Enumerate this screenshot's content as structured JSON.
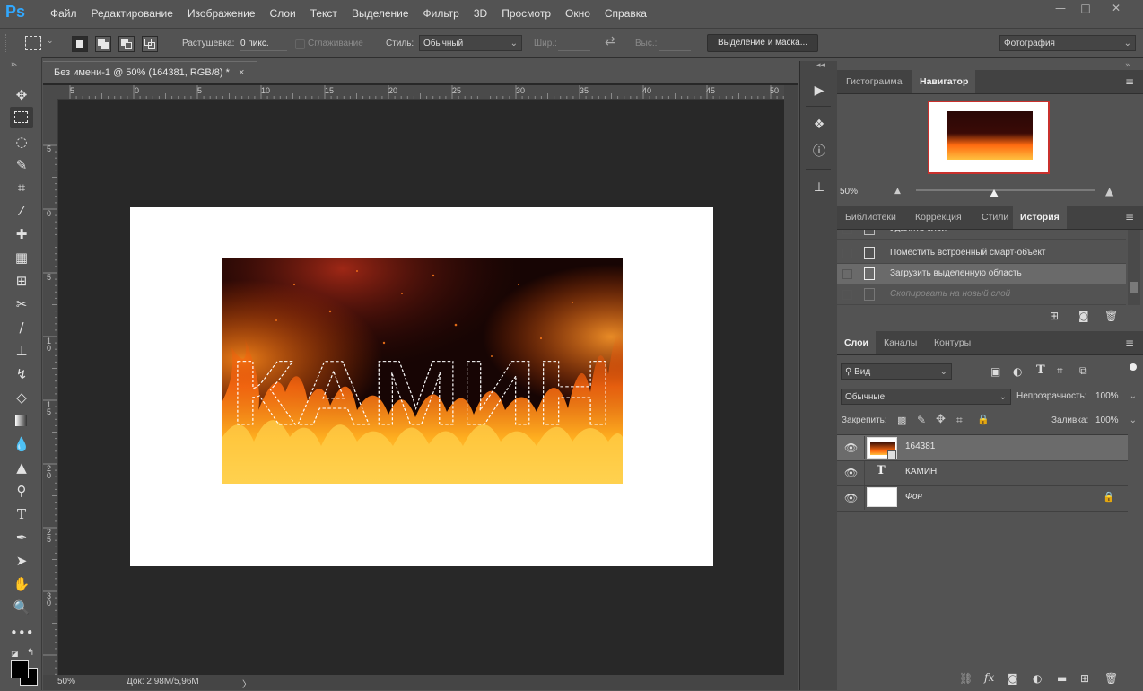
{
  "menubar": {
    "logo": "Ps",
    "items": [
      "Файл",
      "Редактирование",
      "Изображение",
      "Слои",
      "Текст",
      "Выделение",
      "Фильтр",
      "3D",
      "Просмотр",
      "Окно",
      "Справка"
    ],
    "minimize": "—",
    "maximize": "□",
    "close": "✕"
  },
  "options": {
    "feather_label": "Растушевка:",
    "feather_value": "0 пикс.",
    "antialias_label": "Сглаживание",
    "style_label": "Стиль:",
    "style_value": "Обычный",
    "width_label": "Шир.:",
    "height_label": "Выс.:",
    "select_mask_button": "Выделение и маска...",
    "workspace_value": "Фотография"
  },
  "document": {
    "tab_title": "Без имени-1 @ 50% (164381, RGB/8) *",
    "close_tab": "×",
    "canvas_text": "КАМИН",
    "ruler_top": [
      "5",
      "0",
      "5",
      "10",
      "15",
      "20",
      "25",
      "30",
      "35",
      "40",
      "45",
      "50"
    ],
    "ruler_left": [
      "5",
      "0",
      "5",
      "10",
      "15",
      "20",
      "25",
      "30"
    ]
  },
  "status": {
    "zoom": "50%",
    "doc_info": "Док: 2,98M/5,96M",
    "arrow": "〉"
  },
  "navigator_panel": {
    "tabs": [
      "Гистограмма",
      "Навигатор"
    ],
    "active_tab": "Навигатор",
    "zoom": "50%"
  },
  "history_panel": {
    "tabs": [
      "Библиотеки",
      "Коррекция",
      "Стили",
      "История"
    ],
    "active_tab": "История",
    "items": [
      {
        "label": "Удалить слой",
        "state": "partial"
      },
      {
        "label": "Поместить встроенный смарт-объект",
        "state": "normal"
      },
      {
        "label": "Загрузить выделенную область",
        "state": "selected"
      },
      {
        "label": "Скопировать на новый слой",
        "state": "undone"
      }
    ]
  },
  "layers_panel": {
    "tabs": [
      "Слои",
      "Каналы",
      "Контуры"
    ],
    "active_tab": "Слои",
    "filter_kind": "Вид",
    "blend_mode": "Обычные",
    "opacity_label": "Непрозрачность:",
    "opacity_value": "100%",
    "lock_label": "Закрепить:",
    "fill_label": "Заливка:",
    "fill_value": "100%",
    "layers": [
      {
        "name": "164381",
        "type": "smart-object",
        "selected": true,
        "locked": false
      },
      {
        "name": "КАМИН",
        "type": "text",
        "selected": false,
        "locked": false
      },
      {
        "name": "Фон",
        "type": "background",
        "selected": false,
        "locked": true
      }
    ]
  },
  "colors": {
    "fire_dark": "#1a0604",
    "fire_bright": "#ffb71e",
    "accent_red": "#c9302c"
  }
}
